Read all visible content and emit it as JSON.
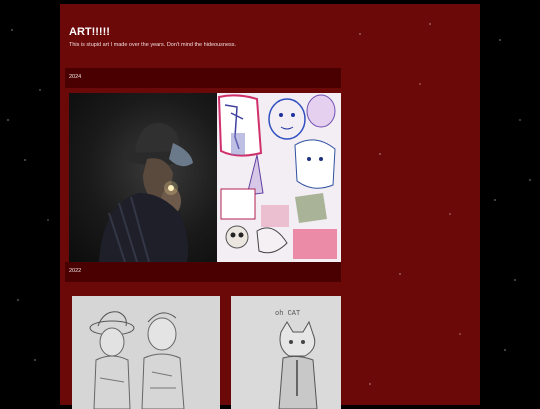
{
  "header": {
    "title": "ART!!!!!",
    "subtitle": "This is stupid art I made over the years. Don't mind the hideousness."
  },
  "sections": [
    {
      "label": "2024"
    },
    {
      "label": "2022"
    }
  ],
  "images": {
    "photo_icon": "smoking-figure-painting",
    "collage_icon": "doodle-collage",
    "sketch1_icon": "pencil-sketch-two-characters",
    "sketch2_icon": "pencil-sketch-cat",
    "sketch2_caption": "oh CAT"
  },
  "colors": {
    "panel": "#6b0808",
    "section_bar": "#4a0000",
    "background": "#000000"
  }
}
